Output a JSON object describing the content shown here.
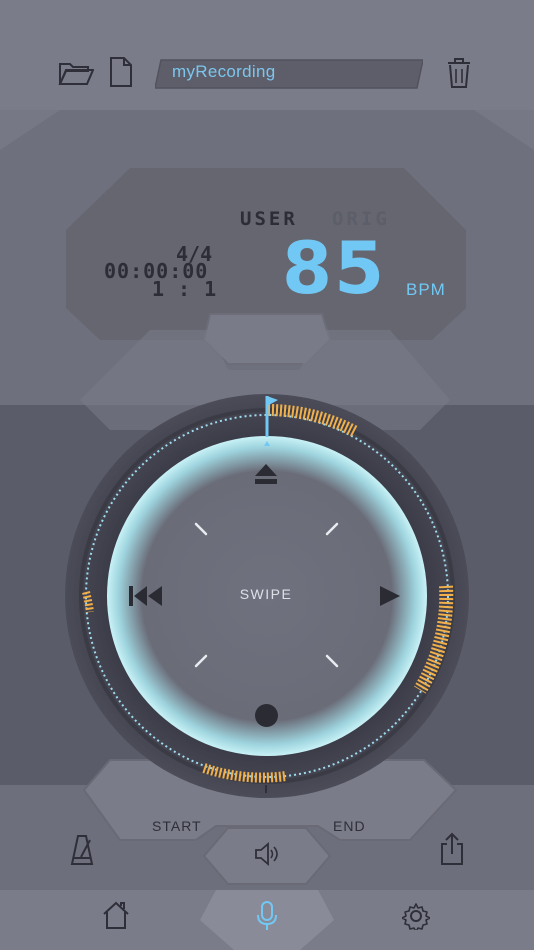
{
  "header": {
    "track_name": "myRecording",
    "icons": {
      "open": "folder-open-icon",
      "new": "new-file-icon",
      "delete": "trash-icon"
    }
  },
  "display": {
    "user_label": "USER",
    "orig_label": "ORIG",
    "time_signature": "4/4",
    "timecode": "00:00:00",
    "position": "1:1",
    "bpm_value": "85",
    "bpm_unit": "BPM"
  },
  "dial": {
    "center_label": "SWIPE",
    "icons": {
      "top": "eject-icon",
      "left": "skip-back-icon",
      "right": "play-icon",
      "bottom": "record-icon"
    }
  },
  "controls": {
    "start_label": "START",
    "end_label": "END",
    "icons": {
      "metronome": "metronome-icon",
      "speaker": "speaker-icon",
      "share": "share-icon"
    }
  },
  "tabbar": {
    "items": [
      {
        "name": "home",
        "icon": "home-icon",
        "active": false
      },
      {
        "name": "record",
        "icon": "microphone-icon",
        "active": true
      },
      {
        "name": "settings",
        "icon": "gear-icon",
        "active": false
      }
    ]
  },
  "colors": {
    "accent": "#72c8f4",
    "waveform": "#f2b04a",
    "background": "#777886"
  }
}
